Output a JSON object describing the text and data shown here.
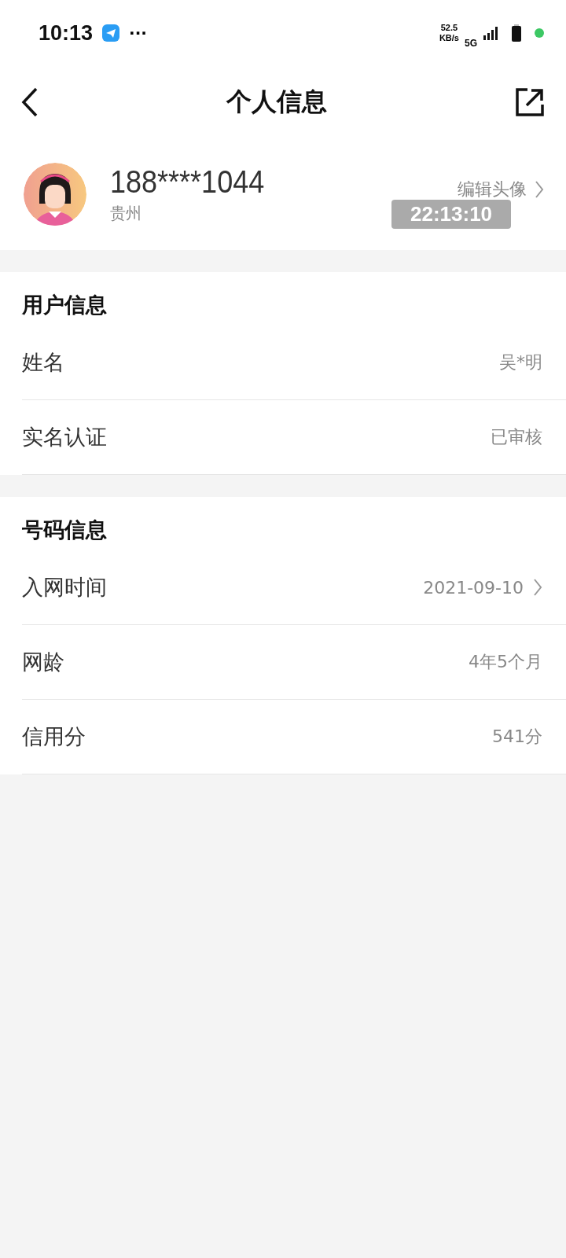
{
  "status_bar": {
    "time": "10:13",
    "more": "···",
    "speed_value": "52.5",
    "speed_unit": "KB/s",
    "network": "5G"
  },
  "header": {
    "title": "个人信息"
  },
  "profile": {
    "phone": "188****1044",
    "region": "贵州",
    "edit_label": "编辑头像",
    "timestamp": "22:13:10"
  },
  "sections": [
    {
      "title": "用户信息",
      "rows": [
        {
          "label": "姓名",
          "value": "吴*明",
          "chevron": false
        },
        {
          "label": "实名认证",
          "value": "已审核",
          "chevron": false
        }
      ]
    },
    {
      "title": "号码信息",
      "rows": [
        {
          "label": "入网时间",
          "value": "2021-09-10",
          "chevron": true
        },
        {
          "label": "网龄",
          "value": "4年5个月",
          "chevron": false
        },
        {
          "label": "信用分",
          "value": "541分",
          "chevron": false
        }
      ]
    }
  ]
}
